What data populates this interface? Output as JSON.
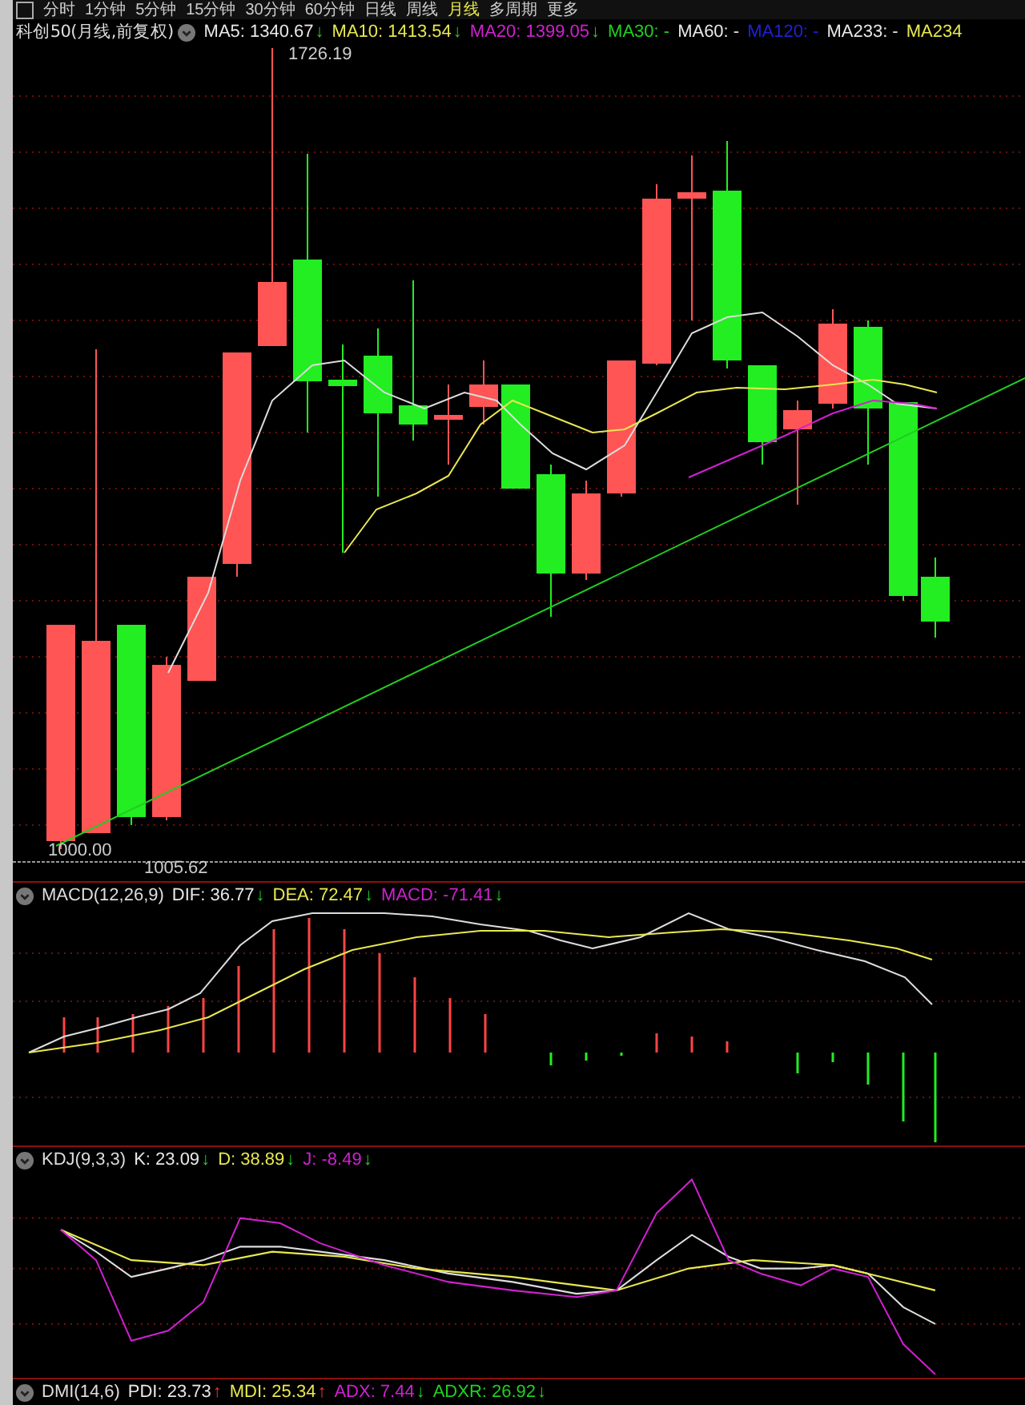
{
  "period_tabs": [
    {
      "label": "分时",
      "selected": false
    },
    {
      "label": "1分钟",
      "selected": false
    },
    {
      "label": "5分钟",
      "selected": false
    },
    {
      "label": "15分钟",
      "selected": false
    },
    {
      "label": "30分钟",
      "selected": false
    },
    {
      "label": "60分钟",
      "selected": false
    },
    {
      "label": "日线",
      "selected": false
    },
    {
      "label": "周线",
      "selected": false
    },
    {
      "label": "月线",
      "selected": true
    },
    {
      "label": "多周期",
      "selected": false
    },
    {
      "label": "更多",
      "selected": false
    }
  ],
  "main": {
    "title": "科创50(月线,前复权)",
    "indicators": [
      {
        "text": "MA5: 1340.67",
        "color": "#e8e8e8",
        "arrow": "↓",
        "rising": false
      },
      {
        "text": "MA10: 1413.54",
        "color": "#e8e850",
        "arrow": "↓",
        "rising": false
      },
      {
        "text": "MA20: 1399.05",
        "color": "#d020d0",
        "arrow": "↓",
        "rising": false
      },
      {
        "text": "MA30: -",
        "color": "#20d020"
      },
      {
        "text": "MA60: -",
        "color": "#e8e8e8"
      },
      {
        "text": "MA120: -",
        "color": "#2020d8"
      },
      {
        "text": "MA233: -",
        "color": "#e8e8e8"
      },
      {
        "text": "MA234",
        "color": "#e8e850"
      }
    ],
    "high_label": "1726.19",
    "low_labels": [
      "1000.00",
      "1005.62"
    ]
  },
  "panels": [
    {
      "kind": "macd",
      "title": "MACD(12,26,9)",
      "indicators": [
        {
          "text": "DIF: 36.77",
          "color": "#e8e8e8",
          "arrow": "↓",
          "rising": false
        },
        {
          "text": "DEA: 72.47",
          "color": "#e8e850",
          "arrow": "↓",
          "rising": false
        },
        {
          "text": "MACD: -71.41",
          "color": "#d020d0",
          "arrow": "↓",
          "rising": false
        }
      ]
    },
    {
      "kind": "kdj",
      "title": "KDJ(9,3,3)",
      "indicators": [
        {
          "text": "K: 23.09",
          "color": "#e8e8e8",
          "arrow": "↓",
          "rising": false
        },
        {
          "text": "D: 38.89",
          "color": "#e8e850",
          "arrow": "↓",
          "rising": false
        },
        {
          "text": "J: -8.49",
          "color": "#d020d0",
          "arrow": "↓",
          "rising": false
        }
      ]
    },
    {
      "kind": "dmi",
      "title": "DMI(14,6)",
      "indicators": [
        {
          "text": "PDI: 23.73",
          "color": "#e8e8e8",
          "arrow": "↑",
          "rising": true
        },
        {
          "text": "MDI: 25.34",
          "color": "#e8e850",
          "arrow": "↑",
          "rising": true
        },
        {
          "text": "ADX: 7.44",
          "color": "#d020d0",
          "arrow": "↓",
          "rising": false
        },
        {
          "text": "ADXR: 26.92",
          "color": "#20d020",
          "arrow": "↓",
          "rising": false
        }
      ]
    }
  ]
}
